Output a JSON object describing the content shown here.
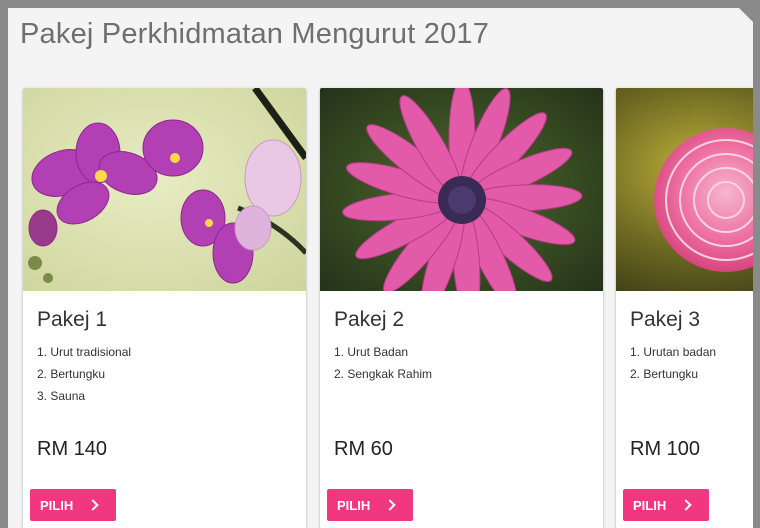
{
  "page": {
    "title": "Pakej Perkhidmatan Mengurut 2017"
  },
  "packages": [
    {
      "title": "Pakej 1",
      "features": [
        "1. Urut tradisional",
        "2. Bertungku",
        "3. Sauna"
      ],
      "price": "RM 140",
      "button_label": "PILIH",
      "image": "purple-orchid-flowers"
    },
    {
      "title": "Pakej 2",
      "features": [
        "1. Urut Badan",
        "2. Sengkak Rahim"
      ],
      "price": "RM 60",
      "button_label": "PILIH",
      "image": "pink-daisy-flower"
    },
    {
      "title": "Pakej 3",
      "features": [
        "1. Urutan badan",
        "2. Bertungku"
      ],
      "price": "RM 100",
      "button_label": "PILIH",
      "image": "pink-dahlia-flower"
    }
  ],
  "colors": {
    "accent": "#f0377f",
    "title_text": "#6f6f6f",
    "background": "#f4f4f4"
  }
}
